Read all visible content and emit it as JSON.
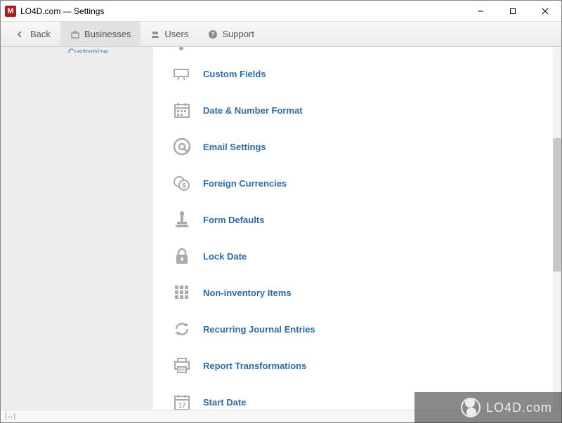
{
  "window": {
    "title": "LO4D.com — Settings",
    "app_icon_letter": "M"
  },
  "toolbar": {
    "back": "Back",
    "businesses": "Businesses",
    "users": "Users",
    "support": "Support"
  },
  "sidebar": {
    "item": "Customize"
  },
  "settings_items": [
    {
      "id": "custom-fields",
      "label": "Custom Fields"
    },
    {
      "id": "date-number-format",
      "label": "Date & Number Format"
    },
    {
      "id": "email-settings",
      "label": "Email Settings"
    },
    {
      "id": "foreign-currencies",
      "label": "Foreign Currencies"
    },
    {
      "id": "form-defaults",
      "label": "Form Defaults"
    },
    {
      "id": "lock-date",
      "label": "Lock Date"
    },
    {
      "id": "non-inventory-items",
      "label": "Non-inventory Items"
    },
    {
      "id": "recurring-journal-entries",
      "label": "Recurring Journal Entries"
    },
    {
      "id": "report-transformations",
      "label": "Report Transformations"
    },
    {
      "id": "start-date",
      "label": "Start Date"
    }
  ],
  "watermark": {
    "text": "LO4D.com"
  },
  "colors": {
    "link": "#2b6cb0",
    "icon_gray": "#aaaaaa",
    "app_red": "#b11a1a"
  }
}
